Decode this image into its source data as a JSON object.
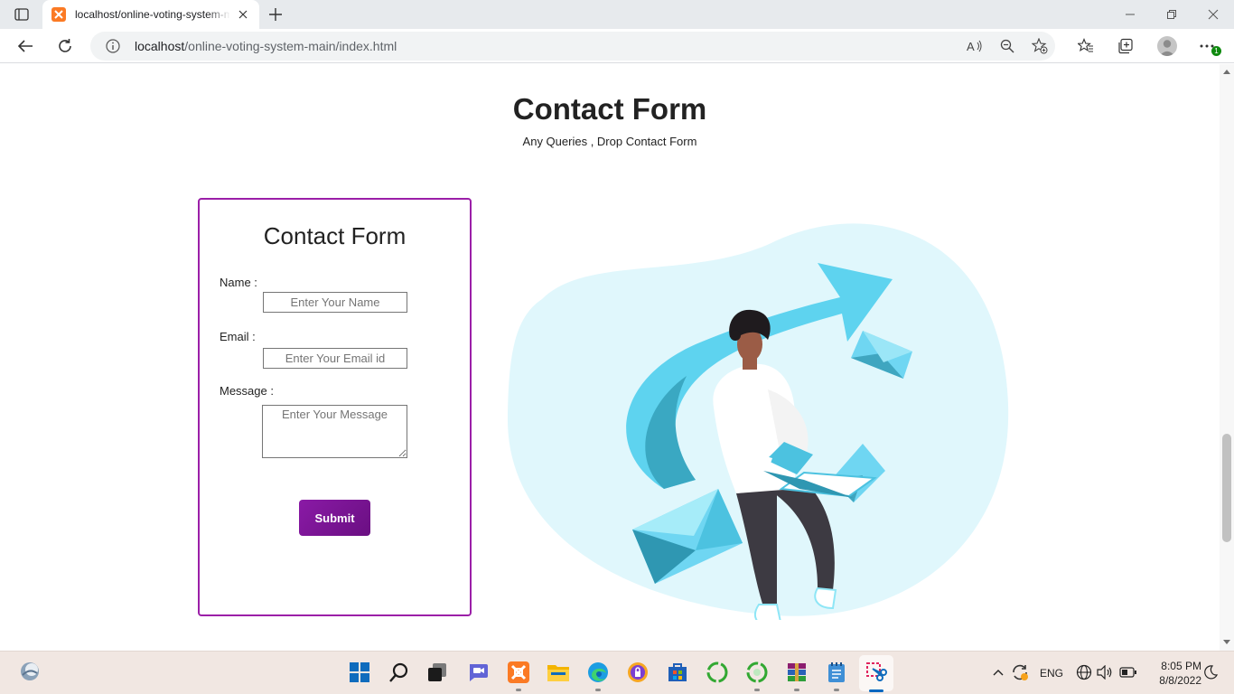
{
  "browser": {
    "tab_title": "localhost/online-voting-system-main/index.html",
    "url_host": "localhost",
    "url_path": "/online-voting-system-main/index.html",
    "profile_badge_count": "1"
  },
  "page": {
    "title": "Contact Form",
    "subtitle": "Any Queries , Drop Contact Form"
  },
  "form": {
    "heading": "Contact Form",
    "name_label": "Name :",
    "name_placeholder": "Enter Your Name",
    "email_label": "Email :",
    "email_placeholder": "Enter Your Email id",
    "message_label": "Message :",
    "message_placeholder": "Enter Your Message",
    "submit_label": "Submit"
  },
  "colors": {
    "accent": "#8a1aa6",
    "illustration_blob": "#e0f7fc",
    "illustration_blue": "#5ed3ef"
  },
  "taskbar": {
    "icons": [
      "start-icon",
      "search-icon",
      "task-view-icon",
      "chat-icon",
      "xampp-icon",
      "file-explorer-icon",
      "edge-icon",
      "vpn-icon",
      "store-icon",
      "app-green-icon",
      "app-green-icon-2",
      "winrar-icon",
      "notepad-icon",
      "snipping-tool-icon"
    ],
    "language": "ENG",
    "time": "8:05 PM",
    "date": "8/8/2022"
  }
}
